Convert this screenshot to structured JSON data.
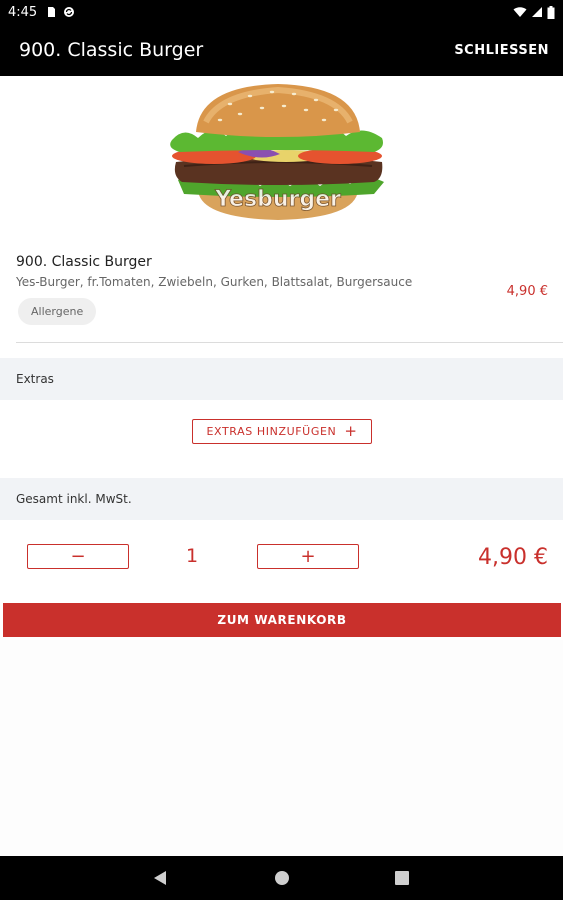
{
  "status_bar": {
    "time": "4:45",
    "left_icons": [
      "sd-card-icon",
      "sync-icon"
    ],
    "right_icons": [
      "wifi-icon",
      "signal-icon",
      "battery-icon"
    ]
  },
  "app_bar": {
    "title": "900. Classic Burger",
    "close_label": "SCHLIESSEN"
  },
  "product": {
    "image_alt": "Yesburger burger",
    "image_watermark": "Yesburger",
    "name": "900. Classic Burger",
    "description": "Yes-Burger, fr.Tomaten, Zwiebeln, Gurken, Blattsalat, Burgersauce",
    "price": "4,90 €",
    "allergen_label": "Allergene"
  },
  "extras": {
    "header": "Extras",
    "add_button_label": "EXTRAS HINZUFÜGEN",
    "add_button_icon": "+"
  },
  "total": {
    "header": "Gesamt inkl. MwSt.",
    "minus_label": "−",
    "plus_label": "+",
    "quantity": "1",
    "price": "4,90 €"
  },
  "cart_button_label": "ZUM WARENKORB",
  "nav_bar": {
    "icons": [
      "back-icon",
      "home-icon",
      "recents-icon"
    ]
  },
  "colors": {
    "accent": "#c9302c",
    "app_bar": "#000000",
    "section_bg": "#f1f3f6"
  }
}
